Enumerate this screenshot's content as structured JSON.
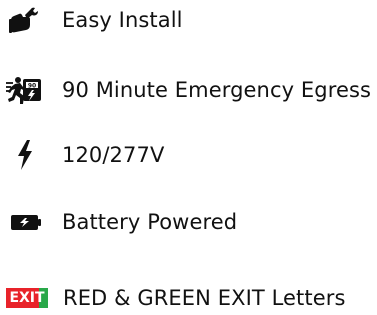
{
  "colors": {
    "text": "#111111",
    "icon": "#111111",
    "exit_red": "#e8232a",
    "exit_green": "#29a84a",
    "exit_text": "#ffffff"
  },
  "features": [
    {
      "icon": "hand-wrench-icon",
      "label": "Easy Install"
    },
    {
      "icon": "running-person-exit-icon",
      "label": "90 Minute Emergency Egress"
    },
    {
      "icon": "lightning-bolt-icon",
      "label": "120/277V"
    },
    {
      "icon": "battery-charging-icon",
      "label": "Battery Powered"
    },
    {
      "icon": "exit-sign-icon",
      "icon_text": "EXIT",
      "label": "RED & GREEN EXIT Letters"
    }
  ]
}
